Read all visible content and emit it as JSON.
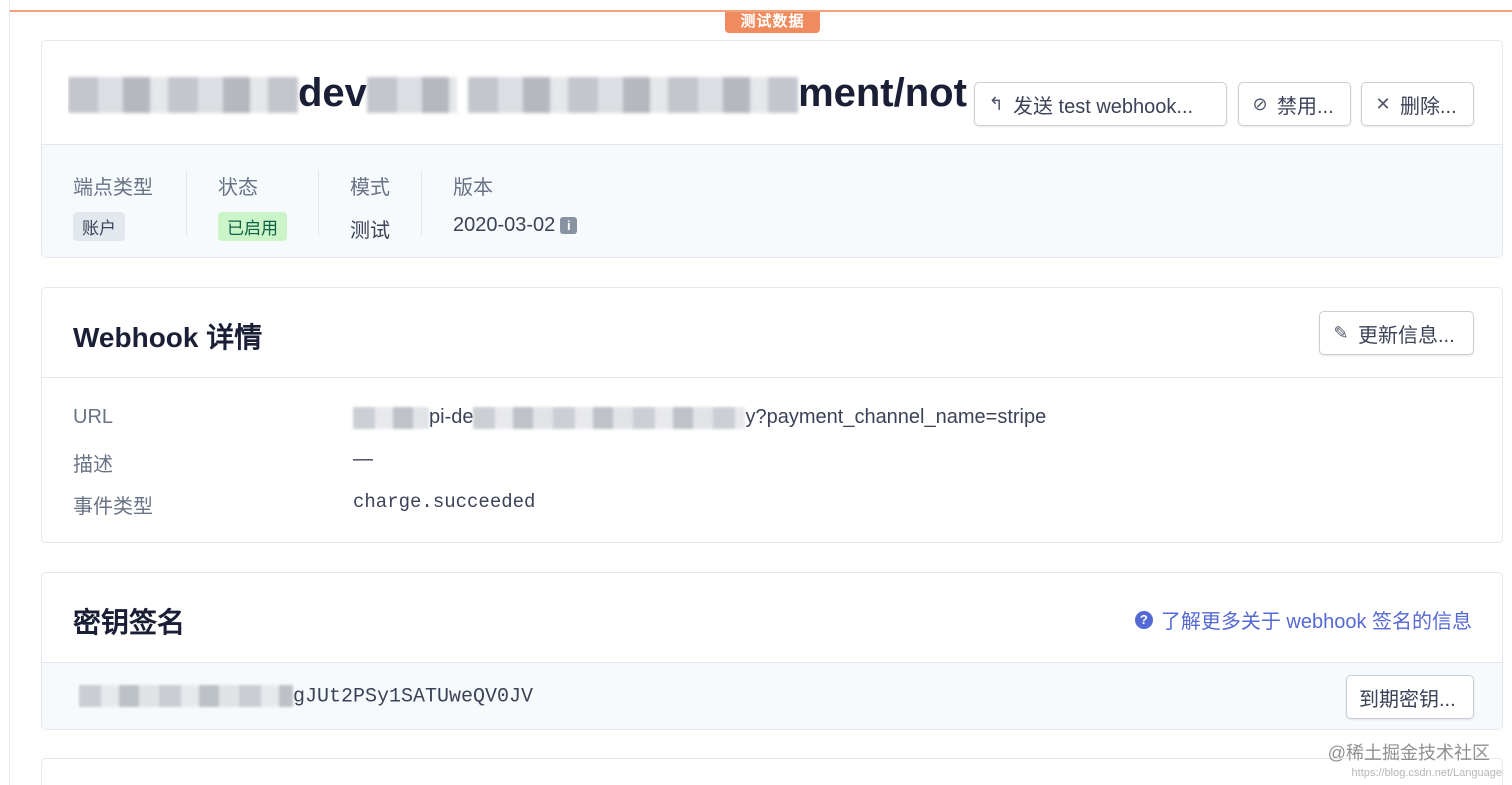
{
  "banner": {
    "test_label": "测试数据"
  },
  "endpoint": {
    "title_visible": "ment/notif…",
    "title_mid": "dev",
    "buttons": {
      "send_test": "发送 test webhook...",
      "disable": "禁用...",
      "delete": "删除..."
    },
    "icons": {
      "send": "undo-arrow-icon",
      "disable": "prohibit-icon",
      "delete": "close-icon"
    },
    "meta": {
      "endpoint_type_label": "端点类型",
      "endpoint_type_value": "账户",
      "status_label": "状态",
      "status_value": "已启用",
      "mode_label": "模式",
      "mode_value": "测试",
      "version_label": "版本",
      "version_value": "2020-03-02"
    }
  },
  "details": {
    "title": "Webhook 详情",
    "update_button": "更新信息...",
    "url_label": "URL",
    "url_visible_a": "pi-de",
    "url_visible_b": "y?payment_channel_name=stripe",
    "description_label": "描述",
    "description_value": "—",
    "event_types_label": "事件类型",
    "event_types_value": "charge.succeeded"
  },
  "signing_secret": {
    "title": "密钥签名",
    "learn_more": "了解更多关于 webhook 签名的信息",
    "secret_visible": "gJUt2PSy1SATUweQV0JV",
    "expire_button": "到期密钥..."
  },
  "watermark": {
    "text": "@稀土掘金技术社区",
    "subtext": "https://blog.csdn.net/Language"
  },
  "colors": {
    "accent": "#5469d4",
    "test_badge": "#ef8b5f",
    "enabled_bg": "#cbf4c9",
    "enabled_text": "#0e6245"
  }
}
